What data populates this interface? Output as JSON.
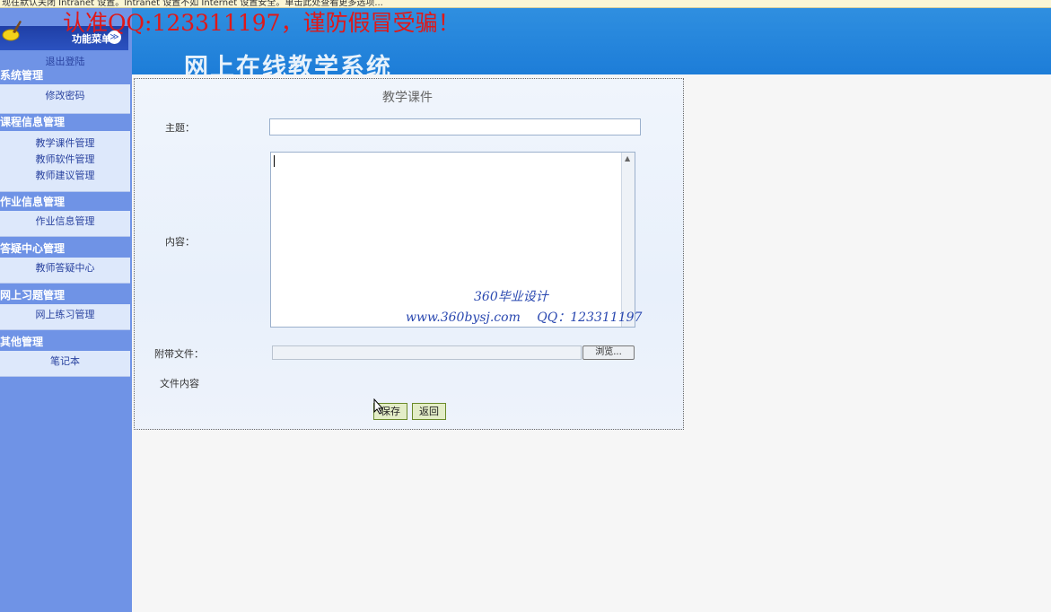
{
  "infobar": {
    "text": "现在默认关闭 Intranet 设置。Intranet 设置不如 Internet 设置安全。单击此处查看更多选项..."
  },
  "watermark_top": "认准QQ:123311197，谨防假冒受骗！",
  "banner": {
    "title": "网上在线教学系统"
  },
  "menu": {
    "header_label": "功能菜单",
    "toggle_symbol": "≫",
    "logout": "退出登陆",
    "sections": [
      {
        "title": "系统管理",
        "items": [
          "修改密码"
        ]
      },
      {
        "title": "课程信息管理",
        "items": [
          "教学课件管理",
          "教师软件管理",
          "教师建议管理"
        ]
      },
      {
        "title": "作业信息管理",
        "items": [
          "作业信息管理"
        ]
      },
      {
        "title": "答疑中心管理",
        "items": [
          "教师答疑中心"
        ]
      },
      {
        "title": "网上习题管理",
        "items": [
          "网上练习管理"
        ]
      },
      {
        "title": "其他管理",
        "items": [
          "笔记本"
        ]
      }
    ]
  },
  "form": {
    "title": "教学课件",
    "subject_label": "主题：",
    "subject_value": "",
    "content_label": "内容：",
    "attach_label": "附带文件：",
    "browse_label": "浏览...",
    "file_content_label": "文件内容",
    "save_label": "保存",
    "back_label": "返回"
  },
  "watermark": {
    "line1": "360毕业设计",
    "line2": "www.360bysj.com　 QQ：123311197"
  }
}
